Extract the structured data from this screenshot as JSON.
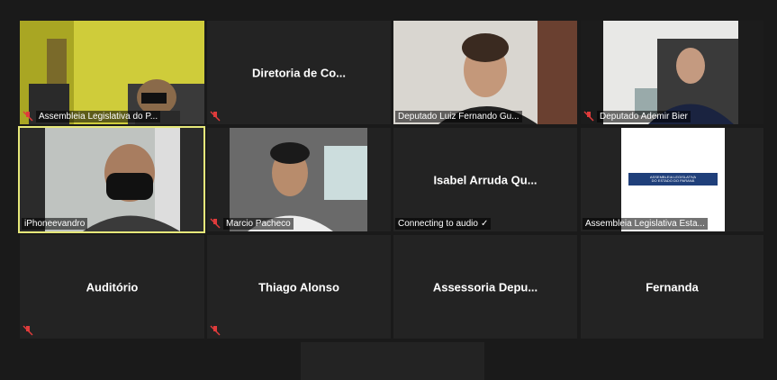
{
  "tiles": [
    {
      "name": "Assembleia Legislativa do P...",
      "type": "video",
      "muted": true
    },
    {
      "name": "Diretoria de Co...",
      "type": "name",
      "muted": true
    },
    {
      "name": "Deputado Luiz Fernando Gu...",
      "type": "video",
      "muted": false
    },
    {
      "name": "Deputado Ademir Bier",
      "type": "video",
      "muted": true
    },
    {
      "name": "iPhoneevandro",
      "type": "video",
      "muted": false,
      "active": true
    },
    {
      "name": "Marcio Pacheco",
      "type": "video",
      "muted": true
    },
    {
      "center": "Isabel Arruda Qu...",
      "status": "Connecting to audio",
      "status_icon": "✓",
      "type": "name"
    },
    {
      "name": "Assembleia Legislativa Esta...",
      "type": "logo",
      "muted": false,
      "logo_text": "ASSEMBLEIA LEGISLATIVA\nDO ESTADO DO PARANÁ"
    },
    {
      "center": "Auditório",
      "type": "name",
      "muted": true
    },
    {
      "center": "Thiago Alonso",
      "type": "name",
      "muted": true
    },
    {
      "center": "Assessoria Depu...",
      "type": "name",
      "muted": false
    },
    {
      "center": "Fernanda",
      "type": "name",
      "muted": false
    }
  ],
  "colors": {
    "background": "#1a1a1a",
    "tile": "#232323",
    "active_border": "#e6e87a",
    "muted_icon": "#e03b3b"
  }
}
